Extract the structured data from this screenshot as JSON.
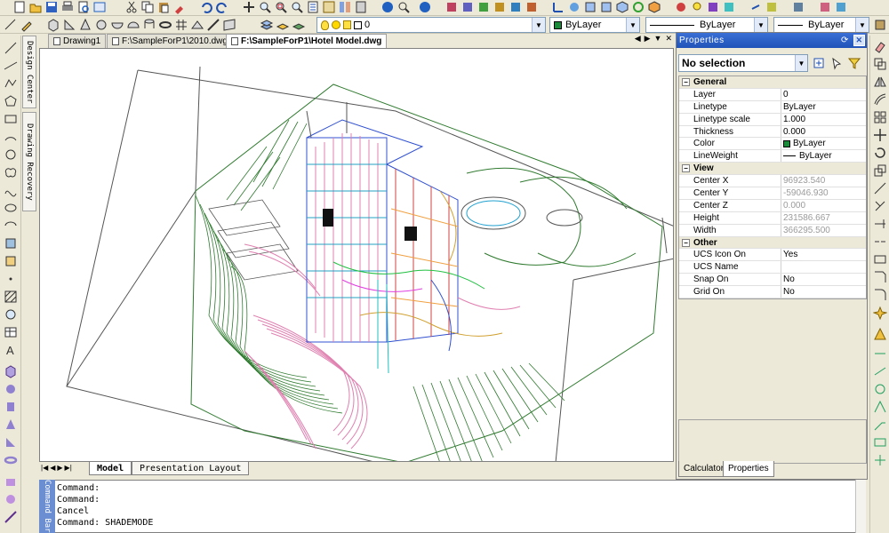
{
  "toolbars": {
    "row1_icons": [
      "new-icon",
      "open-icon",
      "save-icon",
      "print-icon",
      "preview-icon",
      "publish-icon",
      "cut-icon",
      "copy-icon",
      "paste-icon",
      "match-properties-icon",
      "undo-icon",
      "redo-icon",
      "pan-icon",
      "zoom-realtime-icon",
      "zoom-window-icon",
      "zoom-previous-icon",
      "properties-icon",
      "design-center-icon",
      "tool-palette-icon",
      "calculator-icon",
      "help-icon"
    ],
    "layer_value": "0",
    "color_value": "ByLayer",
    "linetype_value": "ByLayer",
    "lineweight_value": "ByLayer"
  },
  "doc_tabs": [
    {
      "label": "Drawing1"
    },
    {
      "label": "F:\\SampleForP1\\2010.dwg"
    },
    {
      "label": "F:\\SampleForP1\\Hotel Model.dwg"
    }
  ],
  "side_tabs": {
    "design_center": "Design Center",
    "drawing_recovery": "Drawing Recovery"
  },
  "layout_tabs": {
    "model": "Model",
    "presentation": "Presentation Layout"
  },
  "command": {
    "tab_label": "Command Bar",
    "lines": [
      "Command:",
      "Command:",
      "Cancel",
      "Command: SHADEMODE"
    ]
  },
  "properties": {
    "title": "Properties",
    "selection": "No selection",
    "general": {
      "header": "General",
      "rows": [
        {
          "k": "Layer",
          "v": "0"
        },
        {
          "k": "Linetype",
          "v": "ByLayer"
        },
        {
          "k": "Linetype scale",
          "v": "1.000"
        },
        {
          "k": "Thickness",
          "v": "0.000"
        },
        {
          "k": "Color",
          "v": "ByLayer"
        },
        {
          "k": "LineWeight",
          "v": "ByLayer"
        }
      ]
    },
    "view": {
      "header": "View",
      "rows": [
        {
          "k": "Center X",
          "v": "96923.540"
        },
        {
          "k": "Center Y",
          "v": "-59046.930"
        },
        {
          "k": "Center Z",
          "v": "0.000"
        },
        {
          "k": "Height",
          "v": "231586.667"
        },
        {
          "k": "Width",
          "v": "366295.500"
        }
      ]
    },
    "other": {
      "header": "Other",
      "rows": [
        {
          "k": "UCS Icon On",
          "v": "Yes"
        },
        {
          "k": "UCS Name",
          "v": ""
        },
        {
          "k": "Snap On",
          "v": "No"
        },
        {
          "k": "Grid On",
          "v": "No"
        }
      ]
    },
    "bottom_tabs": {
      "calculator": "Calculator",
      "properties": "Properties"
    }
  },
  "colors": {
    "title_blue": "#2153b8",
    "bylayer_swatch": "#1a8a3a",
    "terrain_green": "#2f7a2f",
    "building_pink": "#e080b0",
    "building_blue": "#3050d0"
  }
}
